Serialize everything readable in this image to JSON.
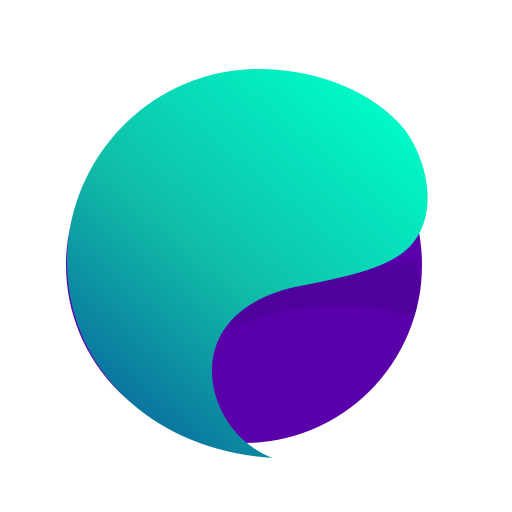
{
  "logo": {
    "icon": "orb-logo-icon",
    "colors": {
      "background": "#ffffff",
      "teal_light": "#00FAC8",
      "teal_mid": "#10BEA8",
      "teal_dark": "#0A6E9E",
      "purple": "#5A00AA",
      "purple_shadow": "#4C0095"
    }
  }
}
